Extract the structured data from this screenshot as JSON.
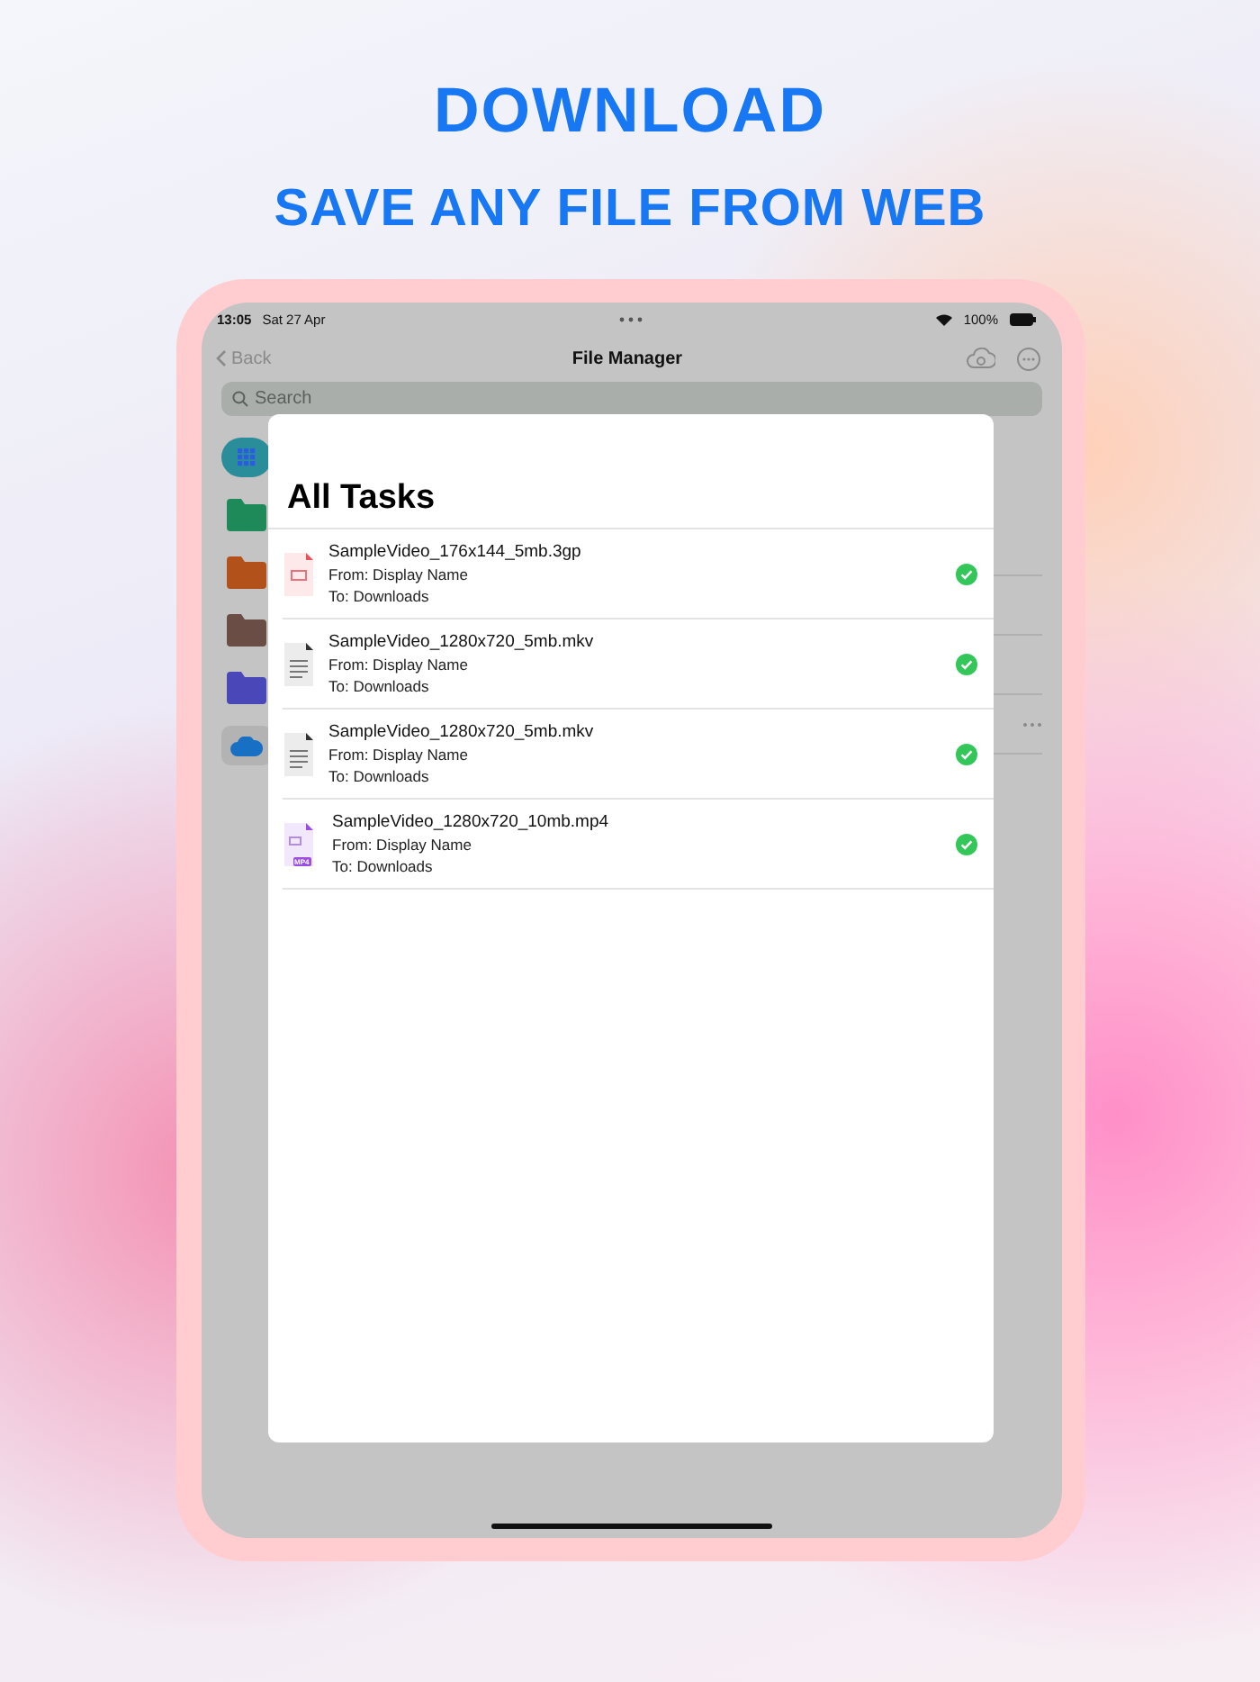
{
  "headline": {
    "title": "DOWNLOAD",
    "subtitle": "SAVE ANY FILE FROM WEB"
  },
  "status_bar": {
    "time": "13:05",
    "date": "Sat 27 Apr",
    "battery": "100%"
  },
  "nav_bar": {
    "back": "Back",
    "title": "File Manager"
  },
  "search": {
    "placeholder": "Search"
  },
  "sidebar": {
    "items": [
      {
        "kind": "grid",
        "selected": true
      },
      {
        "kind": "folder",
        "color": "#1e8a5a",
        "selected": false
      },
      {
        "kind": "folder",
        "color": "#b2521a",
        "selected": false
      },
      {
        "kind": "folder",
        "color": "#6a4e46",
        "selected": false
      },
      {
        "kind": "folder",
        "color": "#4a48b8",
        "selected": false
      },
      {
        "kind": "cloud",
        "selected": false
      }
    ]
  },
  "modal": {
    "title": "All Tasks",
    "tasks": [
      {
        "name": "SampleVideo_176x144_5mb.3gp",
        "from": "From: Display Name",
        "to": "To: Downloads",
        "kind": "video",
        "done": true
      },
      {
        "name": "SampleVideo_1280x720_5mb.mkv",
        "from": "From: Display Name",
        "to": "To: Downloads",
        "kind": "document",
        "done": true
      },
      {
        "name": "SampleVideo_1280x720_5mb.mkv",
        "from": "From: Display Name",
        "to": "To: Downloads",
        "kind": "document",
        "done": true
      },
      {
        "name": "SampleVideo_1280x720_10mb.mp4",
        "from": "From: Display Name",
        "to": "To: Downloads",
        "kind": "mp4",
        "badge": "MP4",
        "done": true
      }
    ]
  }
}
